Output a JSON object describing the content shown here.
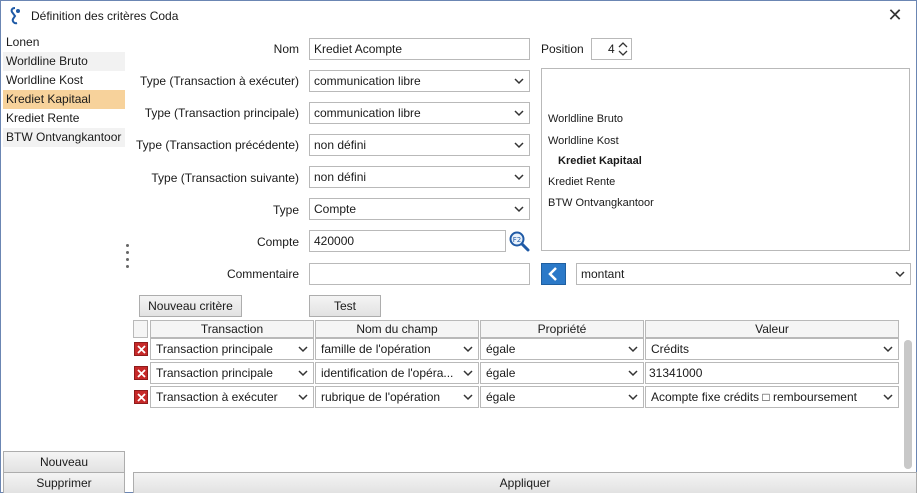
{
  "window": {
    "title": "Définition des critères Coda",
    "close_glyph": "✕"
  },
  "left_list": {
    "items": [
      {
        "label": "Lonen"
      },
      {
        "label": "Worldline Bruto"
      },
      {
        "label": "Worldline Kost"
      },
      {
        "label": "Krediet Kapitaal",
        "selected": true
      },
      {
        "label": "Krediet Rente"
      },
      {
        "label": "BTW Ontvangkantoor"
      }
    ]
  },
  "form": {
    "nom": {
      "label": "Nom",
      "value": "Krediet Acompte"
    },
    "position": {
      "label": "Position",
      "value": "4"
    },
    "type_exec": {
      "label": "Type (Transaction à exécuter)",
      "value": "communication libre"
    },
    "type_principale": {
      "label": "Type (Transaction principale)",
      "value": "communication libre"
    },
    "type_precedente": {
      "label": "Type (Transaction précédente)",
      "value": "non défini"
    },
    "type_suivante": {
      "label": "Type (Transaction suivante)",
      "value": "non défini"
    },
    "type": {
      "label": "Type",
      "value": "Compte"
    },
    "compte": {
      "label": "Compte",
      "value": "420000"
    },
    "commentaire": {
      "label": "Commentaire",
      "value": ""
    },
    "montant_select": {
      "value": "montant"
    }
  },
  "preview": {
    "items": [
      {
        "label": "Worldline Bruto"
      },
      {
        "label": "Worldline Kost"
      },
      {
        "label": "Krediet Kapitaal",
        "bold": true
      },
      {
        "label": "Krediet Rente"
      },
      {
        "label": "BTW Ontvangkantoor"
      }
    ]
  },
  "buttons": {
    "nouveau_critere": "Nouveau critère",
    "test": "Test",
    "nouveau": "Nouveau",
    "supprimer": "Supprimer",
    "appliquer": "Appliquer"
  },
  "grid": {
    "headers": [
      "Transaction",
      "Nom du champ",
      "Propriété",
      "Valeur"
    ],
    "rows": [
      {
        "transaction": "Transaction principale",
        "champ": "famille de l'opération",
        "propriete": "égale",
        "valeur": "Crédits",
        "valeur_is_select": true
      },
      {
        "transaction": "Transaction principale",
        "champ": "identification de l'opéra...",
        "propriete": "égale",
        "valeur": "31341000",
        "valeur_is_select": false
      },
      {
        "transaction": "Transaction à exécuter",
        "champ": "rubrique de l'opération",
        "propriete": "égale",
        "valeur": "Acompte fixe crédits □ remboursement",
        "valeur_is_select": true
      }
    ]
  },
  "colors": {
    "selected_row": "#f7d29b",
    "accent_blue": "#2b79c8",
    "delete_red": "#c62828"
  },
  "icons": {
    "app": "coda-app-icon",
    "search": "search-icon",
    "back": "chevron-left-icon",
    "delete": "delete-icon"
  }
}
